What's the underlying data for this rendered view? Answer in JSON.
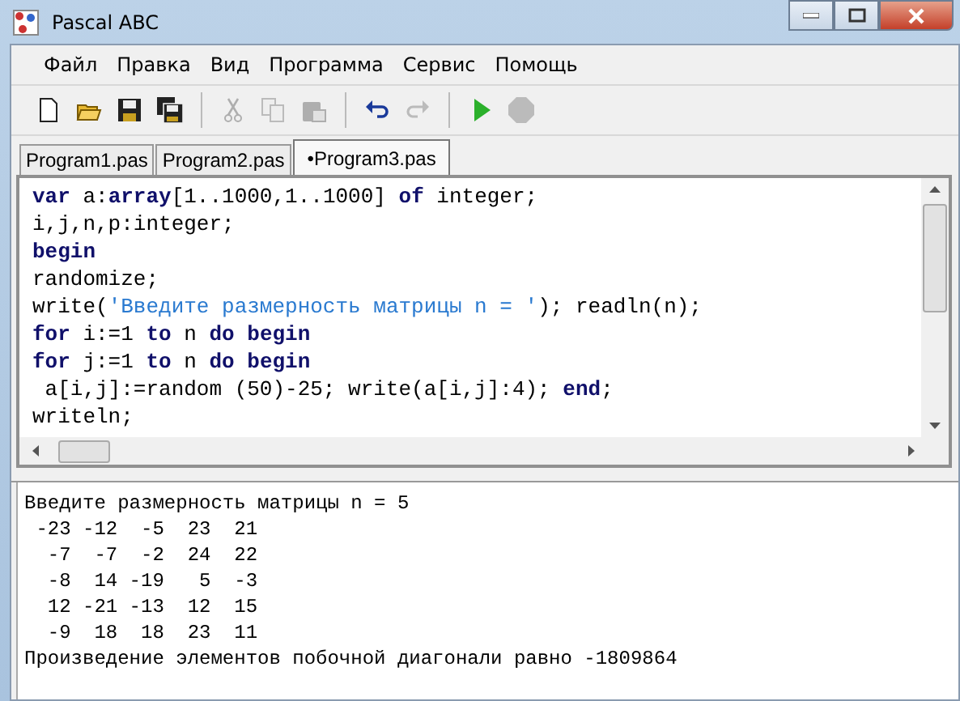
{
  "window": {
    "title": "Pascal ABC"
  },
  "menu": [
    "Файл",
    "Правка",
    "Вид",
    "Программа",
    "Сервис",
    "Помощь"
  ],
  "toolbar": [
    {
      "kind": "new",
      "disabled": false
    },
    {
      "kind": "open",
      "disabled": false
    },
    {
      "kind": "save",
      "disabled": false
    },
    {
      "kind": "saveall",
      "disabled": false
    },
    {
      "kind": "sep"
    },
    {
      "kind": "cut",
      "disabled": true
    },
    {
      "kind": "copy",
      "disabled": true
    },
    {
      "kind": "paste",
      "disabled": true
    },
    {
      "kind": "sep"
    },
    {
      "kind": "undo",
      "disabled": false
    },
    {
      "kind": "redo",
      "disabled": true
    },
    {
      "kind": "sep"
    },
    {
      "kind": "run",
      "disabled": false
    },
    {
      "kind": "stop",
      "disabled": true
    }
  ],
  "tabs": [
    {
      "label": "Program1.pas",
      "selected": false
    },
    {
      "label": "Program2.pas",
      "selected": false
    },
    {
      "label": "•Program3.pas",
      "selected": true
    }
  ],
  "code": [
    [
      {
        "kind": "kw",
        "text": "var"
      },
      {
        "kind": "plain",
        "text": " a:"
      },
      {
        "kind": "kw",
        "text": "array"
      },
      {
        "kind": "plain",
        "text": "[1..1000,1..1000] "
      },
      {
        "kind": "kw",
        "text": "of"
      },
      {
        "kind": "plain",
        "text": " integer;"
      }
    ],
    [
      {
        "kind": "plain",
        "text": "i,j,n,p:integer;"
      }
    ],
    [
      {
        "kind": "kw",
        "text": "begin"
      }
    ],
    [
      {
        "kind": "plain",
        "text": "randomize;"
      }
    ],
    [
      {
        "kind": "plain",
        "text": "write("
      },
      {
        "kind": "str",
        "text": "'Введите размерность матрицы n = '"
      },
      {
        "kind": "plain",
        "text": "); readln(n);"
      }
    ],
    [
      {
        "kind": "kw",
        "text": "for"
      },
      {
        "kind": "plain",
        "text": " i:=1 "
      },
      {
        "kind": "kw",
        "text": "to"
      },
      {
        "kind": "plain",
        "text": " n "
      },
      {
        "kind": "kw",
        "text": "do begin"
      }
    ],
    [
      {
        "kind": "kw",
        "text": "for"
      },
      {
        "kind": "plain",
        "text": " j:=1 "
      },
      {
        "kind": "kw",
        "text": "to"
      },
      {
        "kind": "plain",
        "text": " n "
      },
      {
        "kind": "kw",
        "text": "do begin"
      }
    ],
    [
      {
        "kind": "plain",
        "text": " a[i,j]:=random (50)-25; write(a[i,j]:4); "
      },
      {
        "kind": "kw",
        "text": "end"
      },
      {
        "kind": "plain",
        "text": ";"
      }
    ],
    [
      {
        "kind": "plain",
        "text": "writeln;"
      }
    ]
  ],
  "output": [
    "Введите размерность матрицы n = 5",
    " -23 -12  -5  23  21",
    "  -7  -7  -2  24  22",
    "  -8  14 -19   5  -3",
    "  12 -21 -13  12  15",
    "  -9  18  18  23  11",
    "Произведение элементов побочной диагонали равно -1809864"
  ]
}
